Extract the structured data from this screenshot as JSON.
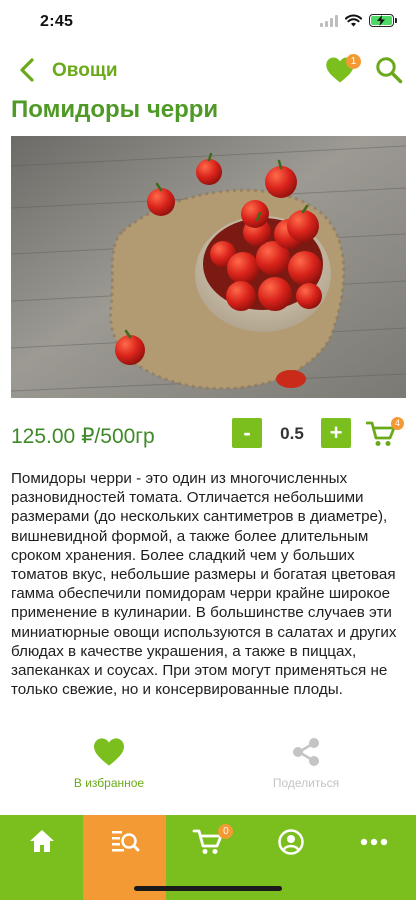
{
  "status_bar": {
    "time": "2:45"
  },
  "header": {
    "title": "Овощи",
    "favorites_count": "1"
  },
  "product": {
    "title": "Помидоры черри",
    "price": "125.00 ₽/500гр",
    "quantity": "0.5",
    "minus_label": "-",
    "plus_label": "+",
    "cart_count": "4",
    "description": "Помидоры черри - это один из многочисленных разновидностей томата. Отличается небольшими размерами (до нескольких сантиметров в диаметре), вишневидной формой, а также более длительным сроком хранения. Более сладкий чем у больших томатов вкус, небольшие размеры и богатая цветовая гамма обеспечили помидорам черри крайне широкое применение в кулинарии. В большинстве случаев эти миниатюрные овощи используются в салатах и других блюдах в качестве украшения, а также в пиццах, запеканках и соусах. При этом могут применяться не только свежие, но и консервированные плоды."
  },
  "actions": {
    "favorite_label": "В избранное",
    "share_label": "Поделиться"
  },
  "tab_bar": {
    "active": "catalog",
    "cart_count": "0",
    "tabs": [
      "home-icon",
      "catalog-search-icon",
      "cart-icon",
      "profile-icon",
      "more-icon"
    ]
  },
  "colors": {
    "brand_green": "#7bbf1e",
    "title_green": "#4f9a26",
    "accent_orange": "#f39a34",
    "share_gray": "#c4c4c4"
  }
}
